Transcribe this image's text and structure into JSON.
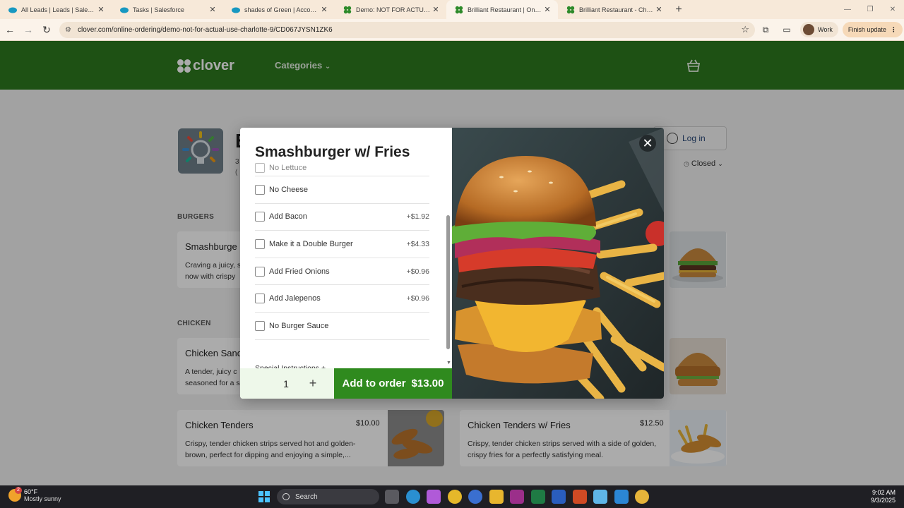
{
  "browser": {
    "tabs": [
      {
        "title": "All Leads | Leads | Salesforce",
        "icon": "salesforce-icon"
      },
      {
        "title": "Tasks | Salesforce",
        "icon": "salesforce-icon"
      },
      {
        "title": "shades of Green | Account | Sal",
        "icon": "salesforce-icon"
      },
      {
        "title": "Demo: NOT FOR ACTUAL USE |",
        "icon": "clover-icon"
      },
      {
        "title": "Brilliant Restaurant | Online Ord",
        "icon": "clover-icon",
        "active": true
      },
      {
        "title": "Brilliant Restaurant - Charlotte,",
        "icon": "clover-icon"
      }
    ],
    "url": "clover.com/online-ordering/demo-not-for-actual-use-charlotte-9/CD067JYSN1ZK6",
    "profile_label": "Work",
    "update_label": "Finish update"
  },
  "header": {
    "logo_text": "clover",
    "categories_label": "Categories"
  },
  "store": {
    "name_snippet": "B",
    "sub1_snippet": "3",
    "sub2_snippet": "(",
    "login_label": "Log in",
    "status_label": "Closed"
  },
  "sections": {
    "burgers": "BURGERS",
    "chicken": "CHICKEN"
  },
  "cards": {
    "smashburger": {
      "name": "Smashburge",
      "desc": "Craving a juicy, s now with crispy"
    },
    "chicken_sandwich": {
      "name": "Chicken Sand",
      "desc": "A tender, juicy c seasoned for a s"
    },
    "chicken_tenders": {
      "name": "Chicken Tenders",
      "price": "$10.00",
      "desc": "Crispy, tender chicken strips served hot and golden-brown, perfect for dipping and enjoying a simple,..."
    },
    "chicken_tenders_fries": {
      "name": "Chicken Tenders w/ Fries",
      "price": "$12.50",
      "desc": "Crispy, tender chicken strips served with a side of golden, crispy fries for a perfectly satisfying meal."
    }
  },
  "modal": {
    "title": "Smashburger w/ Fries",
    "options": [
      {
        "label": "No Lettuce",
        "price": ""
      },
      {
        "label": "No Cheese",
        "price": ""
      },
      {
        "label": "Add Bacon",
        "price": "+$1.92"
      },
      {
        "label": "Make it a Double Burger",
        "price": "+$4.33"
      },
      {
        "label": "Add Fried Onions",
        "price": "+$0.96"
      },
      {
        "label": "Add Jalepenos",
        "price": "+$0.96"
      },
      {
        "label": "No Burger Sauce",
        "price": ""
      }
    ],
    "special_label": "Special Instructions +",
    "quantity": "1",
    "add_label": "Add to order",
    "add_amount": "$13.00"
  },
  "taskbar": {
    "temp": "60°F",
    "weather": "Mostly sunny",
    "weather_badge": "2",
    "search_label": "Search",
    "time": "9:02 AM",
    "date": "9/3/2025"
  },
  "colors": {
    "brand_green": "#2d7a1f",
    "cta_green": "#2f8a1e"
  }
}
